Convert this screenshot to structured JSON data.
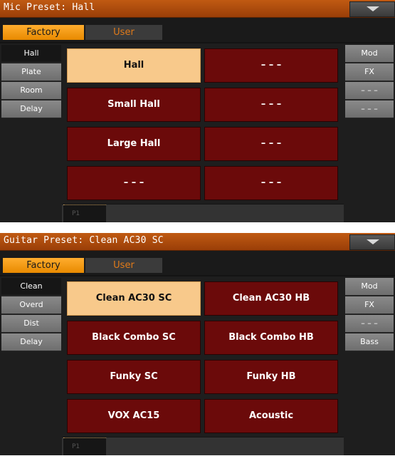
{
  "mic_panel": {
    "title": "Mic Preset: Hall",
    "tabs": {
      "active": "Factory",
      "inactive": "User"
    },
    "left": [
      "Hall",
      "Plate",
      "Room",
      "Delay"
    ],
    "right": [
      "Mod",
      "FX",
      "– – –",
      "– – –"
    ],
    "grid": [
      [
        "Hall",
        "– – –"
      ],
      [
        "Small Hall",
        "– – –"
      ],
      [
        "Large Hall",
        "– – –"
      ],
      [
        "– – –",
        "– – –"
      ]
    ],
    "page": "P1"
  },
  "guitar_panel": {
    "title": "Guitar Preset: Clean AC30 SC",
    "tabs": {
      "active": "Factory",
      "inactive": "User"
    },
    "left": [
      "Clean",
      "Overd",
      "Dist",
      "Delay"
    ],
    "right": [
      "Mod",
      "FX",
      "– – –",
      "Bass"
    ],
    "grid": [
      [
        "Clean AC30 SC",
        "Clean AC30 HB"
      ],
      [
        "Black Combo SC",
        "Black Combo HB"
      ],
      [
        "Funky SC",
        "Funky HB"
      ],
      [
        "VOX AC15",
        "Acoustic"
      ]
    ],
    "page": "P1"
  }
}
